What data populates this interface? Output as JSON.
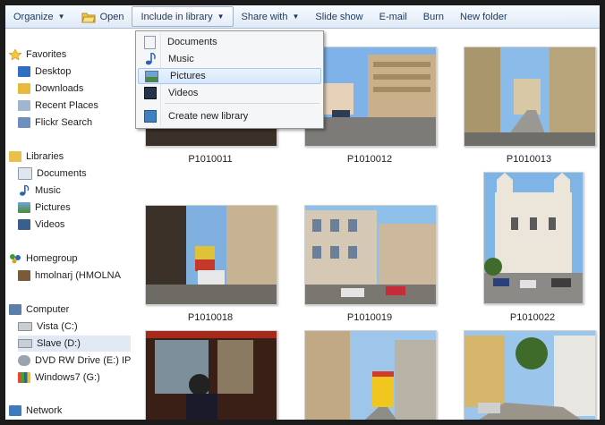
{
  "toolbar": {
    "organize": "Organize",
    "open": "Open",
    "include_in_library": "Include in library",
    "share_with": "Share with",
    "slide_show": "Slide show",
    "email": "E-mail",
    "burn": "Burn",
    "new_folder": "New folder"
  },
  "include_menu": {
    "items": [
      "Documents",
      "Music",
      "Pictures",
      "Videos"
    ],
    "highlighted": "Pictures",
    "create_new_library": "Create new library"
  },
  "sidebar": {
    "favorites": {
      "label": "Favorites",
      "items": [
        "Desktop",
        "Downloads",
        "Recent Places",
        "Flickr Search"
      ]
    },
    "libraries": {
      "label": "Libraries",
      "items": [
        "Documents",
        "Music",
        "Pictures",
        "Videos"
      ]
    },
    "homegroup": {
      "label": "Homegroup",
      "items": [
        "hmolnarj (HMOLNA"
      ]
    },
    "computer": {
      "label": "Computer",
      "items": [
        "Vista (C:)",
        "Slave (D:)",
        "DVD RW Drive (E:) IP",
        "Windows7 (G:)"
      ],
      "selected": "Slave (D:)"
    },
    "network": {
      "label": "Network"
    }
  },
  "files": [
    {
      "name": "P1010011"
    },
    {
      "name": "P1010012"
    },
    {
      "name": "P1010013"
    },
    {
      "name": "P1010018"
    },
    {
      "name": "P1010019"
    },
    {
      "name": "P1010022"
    },
    {
      "name": ""
    },
    {
      "name": ""
    },
    {
      "name": ""
    }
  ],
  "colors": {
    "accent": "#1e395b",
    "selection": "#e1e9f4",
    "menu_hover": "#d6e6fb"
  }
}
